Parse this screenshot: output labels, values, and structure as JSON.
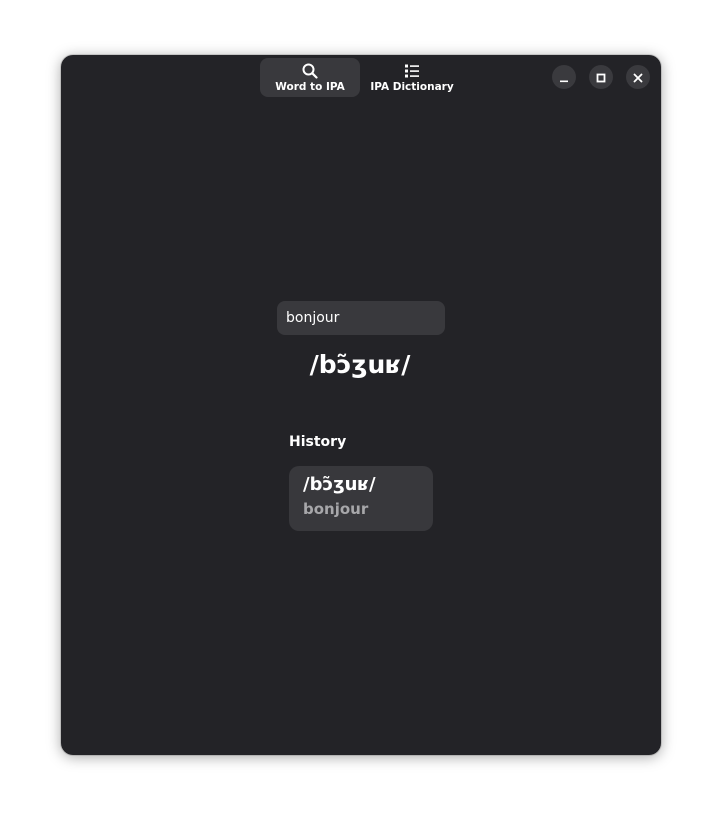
{
  "header": {
    "tabs": [
      {
        "label": "Word to IPA",
        "icon": "search-icon",
        "active": true
      },
      {
        "label": "IPA Dictionary",
        "icon": "list-icon",
        "active": false
      }
    ],
    "window_controls": [
      "minimize-icon",
      "maximize-icon",
      "close-icon"
    ]
  },
  "main": {
    "search_value": "bonjour",
    "result_ipa": "/bɔ̃ʒuʁ/",
    "history_title": "History",
    "history": [
      {
        "ipa": "/bɔ̃ʒuʁ/",
        "word": "bonjour"
      }
    ]
  },
  "colors": {
    "window_bg": "#232327",
    "surface": "#39393d",
    "text": "#ffffff",
    "text_dim": "#a7a7aa"
  }
}
